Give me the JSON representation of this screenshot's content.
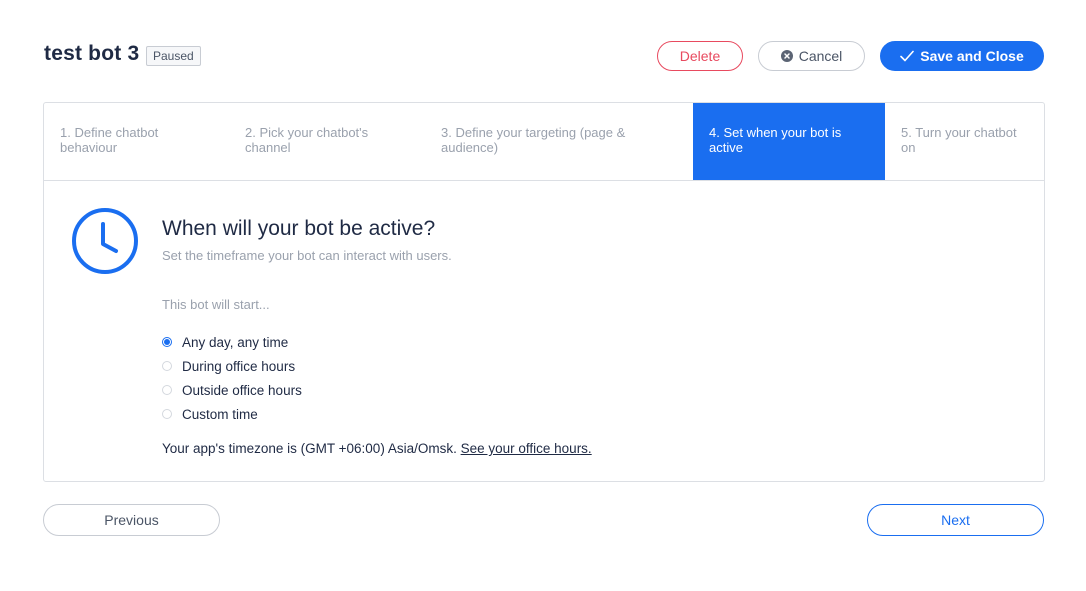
{
  "header": {
    "title": "test bot 3",
    "status": "Paused",
    "delete_label": "Delete",
    "cancel_label": "Cancel",
    "save_label": "Save and Close"
  },
  "steps": [
    {
      "label": "1. Define chatbot behaviour",
      "active": false
    },
    {
      "label": "2. Pick your chatbot's channel",
      "active": false
    },
    {
      "label": "3. Define your targeting (page & audience)",
      "active": false
    },
    {
      "label": "4. Set when your bot is active",
      "active": true
    },
    {
      "label": "5. Turn your chatbot on",
      "active": false
    }
  ],
  "content": {
    "title": "When will your bot be active?",
    "subtitle": "Set the timeframe your bot can interact with users.",
    "start_label": "This bot will start...",
    "options": [
      {
        "label": "Any day, any time",
        "selected": true
      },
      {
        "label": "During office hours",
        "selected": false
      },
      {
        "label": "Outside office hours",
        "selected": false
      },
      {
        "label": "Custom time",
        "selected": false
      }
    ],
    "timezone_text": "Your app's timezone is (GMT +06:00) Asia/Omsk.",
    "office_hours_link": "See your office hours."
  },
  "footer": {
    "previous_label": "Previous",
    "next_label": "Next"
  },
  "colors": {
    "accent": "#1a6ef0",
    "danger": "#e84a5f",
    "muted": "#9aa1ad",
    "text": "#1f2a44"
  },
  "icons": {
    "cancel": "close-circle-icon",
    "save": "checkmark-icon",
    "hero": "clock-icon"
  }
}
